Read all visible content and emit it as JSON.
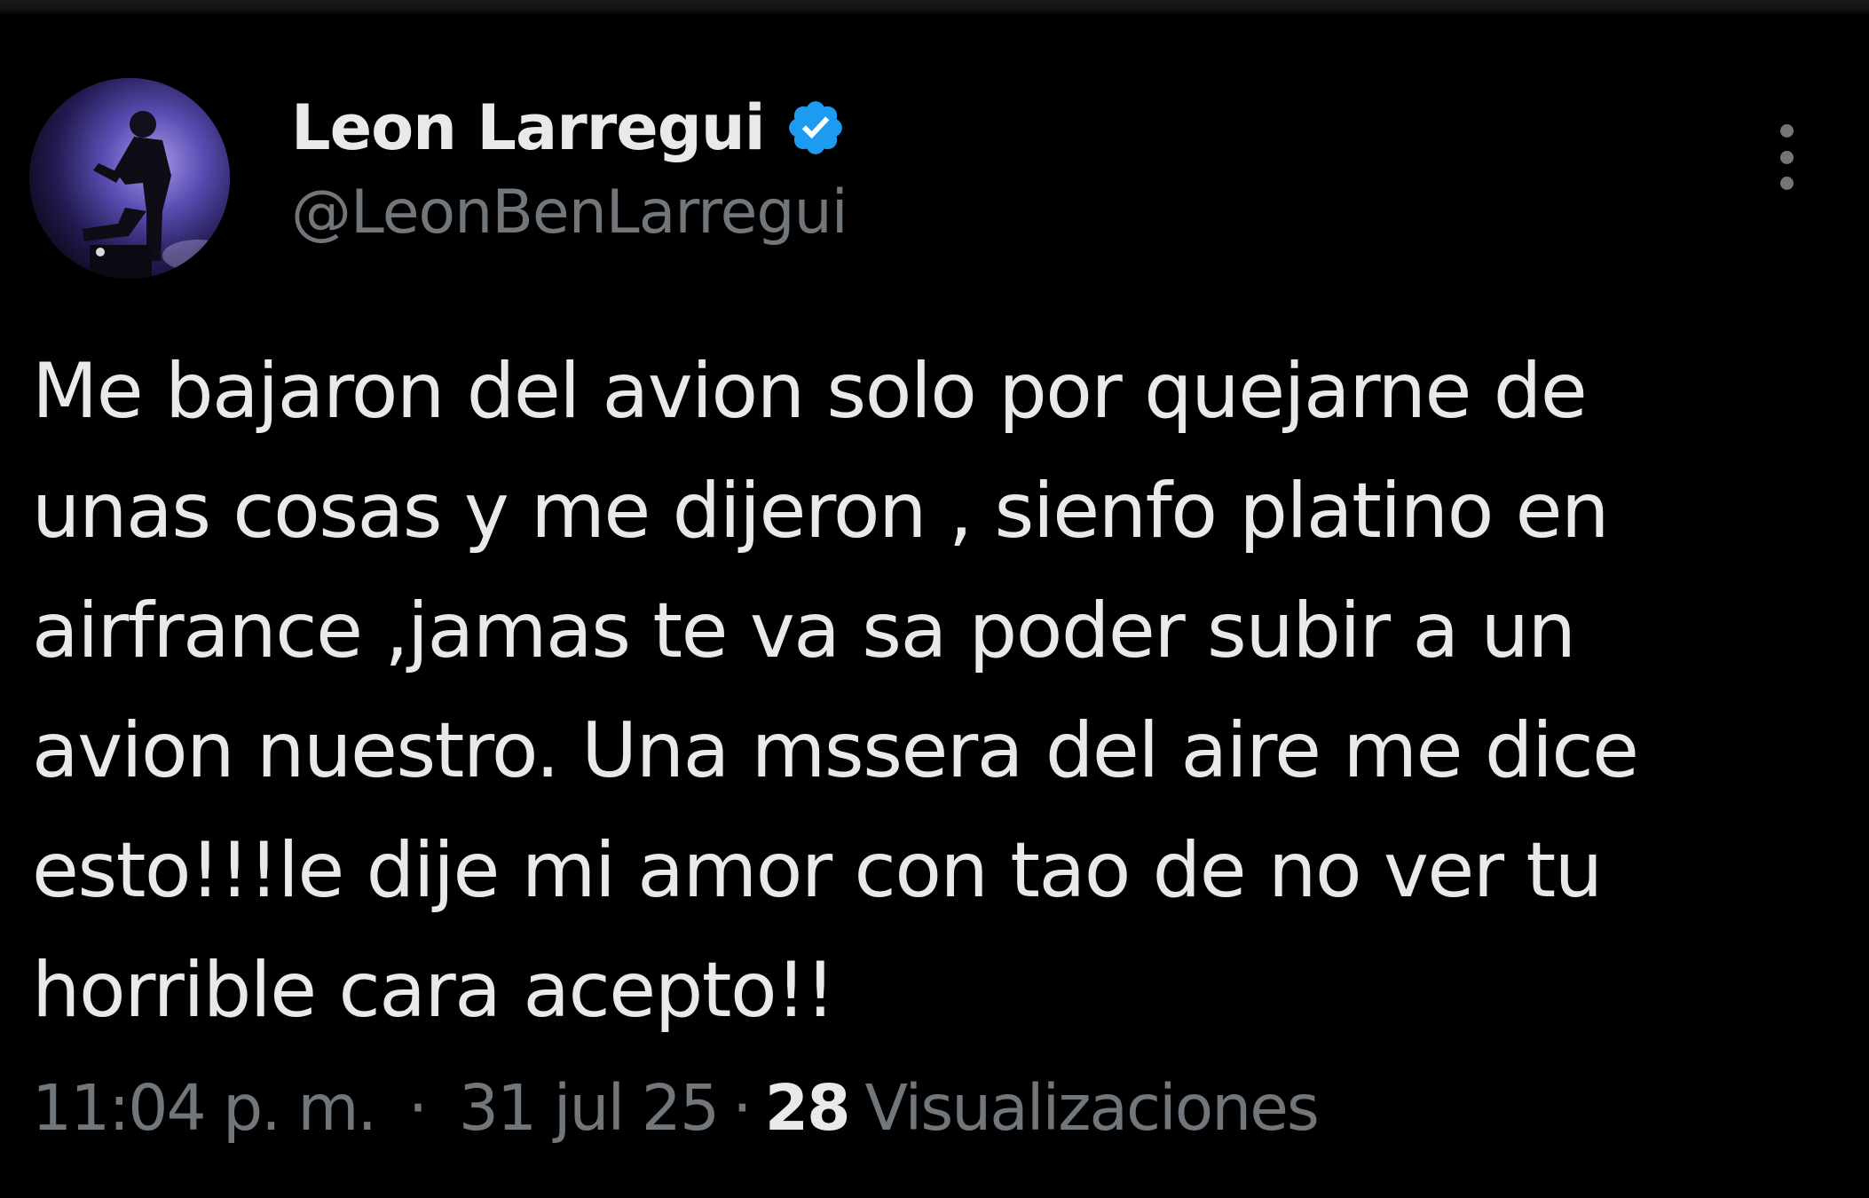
{
  "tweet": {
    "author": {
      "display_name": "Leon Larregui",
      "handle": "@LeonBenLarregui",
      "verified": true
    },
    "text_lines": [
      "Me bajaron del avion solo por quejarne de",
      "unas cosas y me dijeron , sienfo platino en",
      "airfrance ,jamas te va sa poder subir a un",
      "avion nuestro. Una mssera del aire me dice",
      "esto!!!le dije mi amor con tao de no ver tu",
      "horrible cara acepto!!"
    ],
    "meta": {
      "time": "11:04 p. m.",
      "separator": "·",
      "date": "31 jul 25",
      "views_count": "28",
      "views_label": "Visualizaciones"
    }
  },
  "colors": {
    "background": "#000000",
    "primary_text": "#e7e9ea",
    "secondary_text": "#71767b",
    "verified_badge": "#1d9bf0"
  },
  "icons": {
    "verified": "verified-badge-icon",
    "more": "more-dots-icon"
  }
}
